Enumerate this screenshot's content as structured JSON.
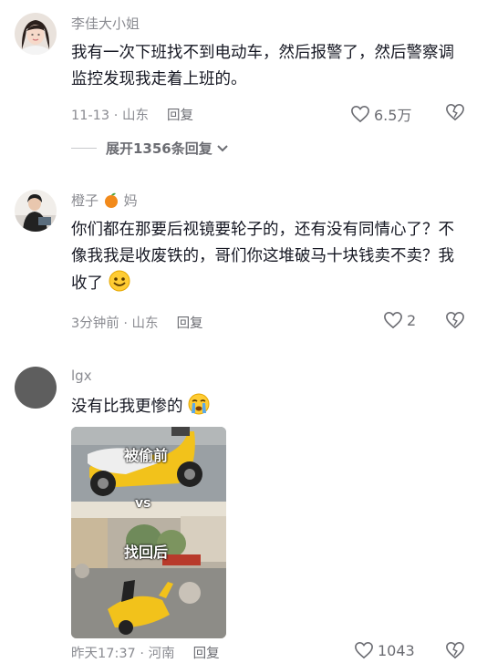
{
  "comments": [
    {
      "username": "李佳大小姐",
      "text": "我有一次下班找不到电动车，然后报警了，然后警察调监控发现我走着上班的。",
      "time_location": "11-13 · 山东",
      "reply_label": "回复",
      "likes": "6.5万",
      "expand_label": "展开1356条回复"
    },
    {
      "username": "橙子",
      "username_suffix": "妈",
      "text": "你们都在那要后视镜要轮子的，还有没有同情心了？不像我我是收废铁的，哥们你这堆破马十块钱卖不卖？我收了",
      "time_location": "3分钟前 · 山东",
      "reply_label": "回复",
      "likes": "2"
    },
    {
      "username": "lgx",
      "text": "没有比我更惨的",
      "image": {
        "caption_top": "被偷前",
        "caption_vs": "vs",
        "caption_bottom": "找回后"
      },
      "time_location": "昨天17:37 · 河南",
      "reply_label": "回复",
      "likes": "1043"
    }
  ],
  "colors": {
    "text_primary": "#161823",
    "text_secondary": "#8a8b91",
    "scooter_yellow": "#f2c21b"
  },
  "icons": [
    "heart-icon",
    "dislike-icon",
    "chevron-down-icon",
    "orange-emoji-icon",
    "smile-emoji-icon",
    "crying-emoji-icon"
  ]
}
